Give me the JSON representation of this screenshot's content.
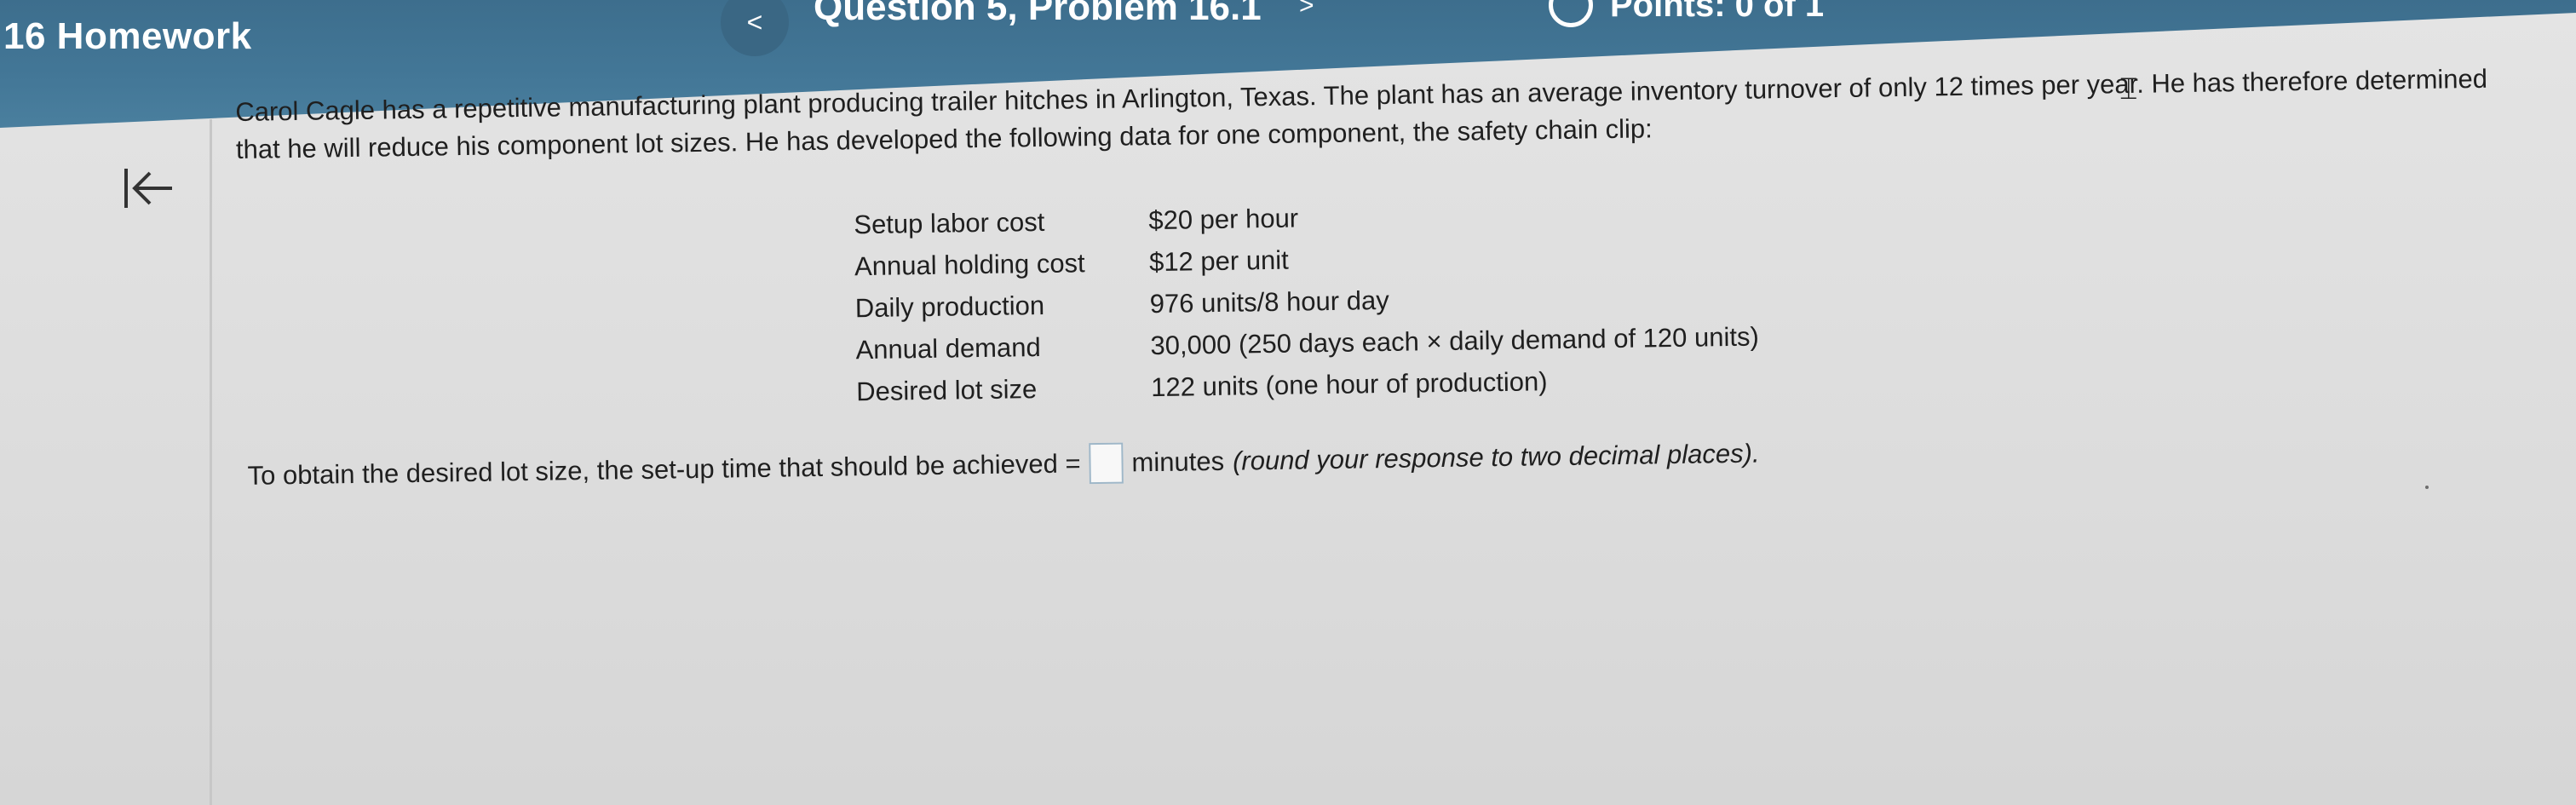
{
  "header": {
    "homework_title": "16 Homework",
    "question_title": "Question 5, Problem 16.1",
    "prev_label": "<",
    "next_label": ">",
    "points_text": "Points: 0 of 1"
  },
  "colors": {
    "header_bg": "#4275944",
    "page_bg": "#dedede"
  },
  "icons": {
    "collapse": "collapse-sidebar-icon",
    "prev": "chevron-left-icon",
    "next": "chevron-right-icon",
    "points": "circle-outline-icon"
  },
  "problem": {
    "intro": "Carol Cagle has a repetitive manufacturing plant producing trailer hitches in Arlington, Texas. The plant has an average inventory turnover of only 12 times per year. He has therefore determined that he will reduce his component lot sizes. He has developed the following data for one component, the safety chain clip:",
    "data_rows": [
      {
        "label": "Setup labor cost",
        "value": "$20 per hour"
      },
      {
        "label": "Annual holding cost",
        "value": "$12 per unit"
      },
      {
        "label": "Daily production",
        "value": "976 units/8 hour day"
      },
      {
        "label": "Annual demand",
        "value": "30,000 (250 days each × daily demand of 120 units)"
      },
      {
        "label": "Desired lot size",
        "value": "122 units (one hour of production)"
      }
    ],
    "answer_prompt": "To obtain the desired lot size, the set-up time that should be achieved =",
    "answer_value": "",
    "answer_unit": "minutes",
    "answer_note": "(round your response to two decimal places)."
  }
}
